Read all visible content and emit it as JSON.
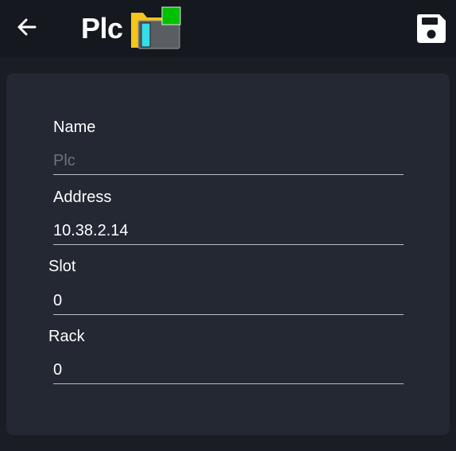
{
  "header": {
    "title": "Plc",
    "back_icon": "arrow-left-icon",
    "device_icon": "plc-folder-icon",
    "save_icon": "floppy-disk-icon",
    "status_color": "#00c000"
  },
  "form": {
    "name": {
      "label": "Name",
      "value": "",
      "placeholder": "Plc"
    },
    "address": {
      "label": "Address",
      "value": "10.38.2.14",
      "placeholder": ""
    },
    "slot": {
      "label": "Slot",
      "value": "0",
      "placeholder": ""
    },
    "rack": {
      "label": "Rack",
      "value": "0",
      "placeholder": ""
    }
  }
}
